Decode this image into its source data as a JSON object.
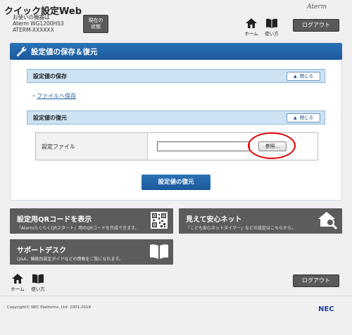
{
  "header": {
    "app_title": "クイック設定Web",
    "device_label": "お使いの機器は",
    "device_model": "Aterm WG1200HS3",
    "device_id": "ATERM-XXXXXX",
    "status_button": [
      "現在の",
      "状態"
    ],
    "brand": "Aterm",
    "home_label": "ホーム",
    "help_label": "使い方",
    "logout_label": "ログアウト"
  },
  "main": {
    "title": "設定値の保存＆復元",
    "save_section": {
      "title": "設定値の保存",
      "close_label": "閉じる",
      "link": "ファイルへ保存"
    },
    "restore_section": {
      "title": "設定値の復元",
      "close_label": "閉じる",
      "file_label": "設定ファイル",
      "file_path": "",
      "browse_label": "参照..."
    },
    "restore_button": "設定値の復元"
  },
  "tiles": {
    "qr": {
      "title": "設定用QRコードを表示",
      "desc": "「AtermらくらくQRスタート」用のQRコードを作成できます。"
    },
    "safe_net": {
      "title": "見えて安心ネット",
      "desc": "「こども安心ネットタイマー」などの設定はこちらから。"
    },
    "support": {
      "title": "サポートデスク",
      "desc": "Q&A、機能別設定ガイドなどの情報をご覧になれます。"
    }
  },
  "footer": {
    "home_label": "ホーム",
    "help_label": "使い方",
    "logout_label": "ログアウト",
    "copyright": "Copyright© NEC Platforms, Ltd. 2001-2018",
    "brand": "NEC"
  },
  "colors": {
    "accent_blue": "#1f64a8",
    "section_blue": "#cde3f3",
    "tile_gray": "#5c5c5c",
    "highlight_red": "#e00000"
  }
}
